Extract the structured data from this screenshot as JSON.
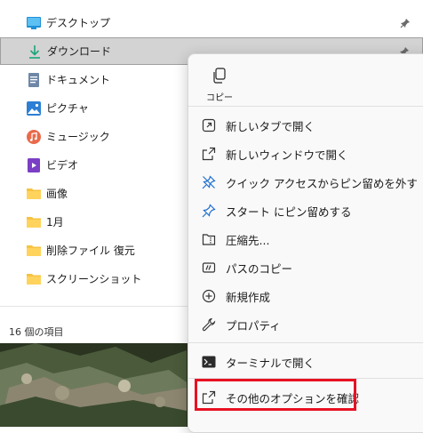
{
  "explorer": {
    "nav_items": [
      {
        "label": "デスクトップ",
        "icon": "desktop-icon",
        "pinned": true
      },
      {
        "label": "ダウンロード",
        "icon": "download-icon",
        "pinned": true,
        "selected": true
      },
      {
        "label": "ドキュメント",
        "icon": "document-icon"
      },
      {
        "label": "ピクチャ",
        "icon": "pictures-icon"
      },
      {
        "label": "ミュージック",
        "icon": "music-icon"
      },
      {
        "label": "ビデオ",
        "icon": "video-icon"
      },
      {
        "label": "画像",
        "icon": "folder-icon"
      },
      {
        "label": "1月",
        "icon": "folder-icon"
      },
      {
        "label": "削除ファイル 復元",
        "icon": "folder-icon"
      },
      {
        "label": "スクリーンショット",
        "icon": "folder-icon"
      }
    ],
    "status": "16 個の項目"
  },
  "context_menu": {
    "copy_label": "コピー",
    "items": [
      {
        "label": "新しいタブで開く",
        "icon": "new-tab-icon"
      },
      {
        "label": "新しいウィンドウで開く",
        "icon": "new-window-icon"
      },
      {
        "label": "クイック アクセスからピン留めを外す",
        "icon": "unpin-icon"
      },
      {
        "label": "スタート にピン留めする",
        "icon": "pin-icon"
      },
      {
        "label": "圧縮先...",
        "icon": "compress-icon"
      },
      {
        "label": "パスのコピー",
        "icon": "copy-path-icon"
      },
      {
        "label": "新規作成",
        "icon": "new-icon"
      },
      {
        "label": "プロパティ",
        "icon": "wrench-icon"
      },
      {
        "label": "ターミナルで開く",
        "icon": "terminal-icon"
      },
      {
        "label": "その他のオプションを確認",
        "icon": "more-options-icon"
      }
    ],
    "highlight_color": "#e81123"
  }
}
